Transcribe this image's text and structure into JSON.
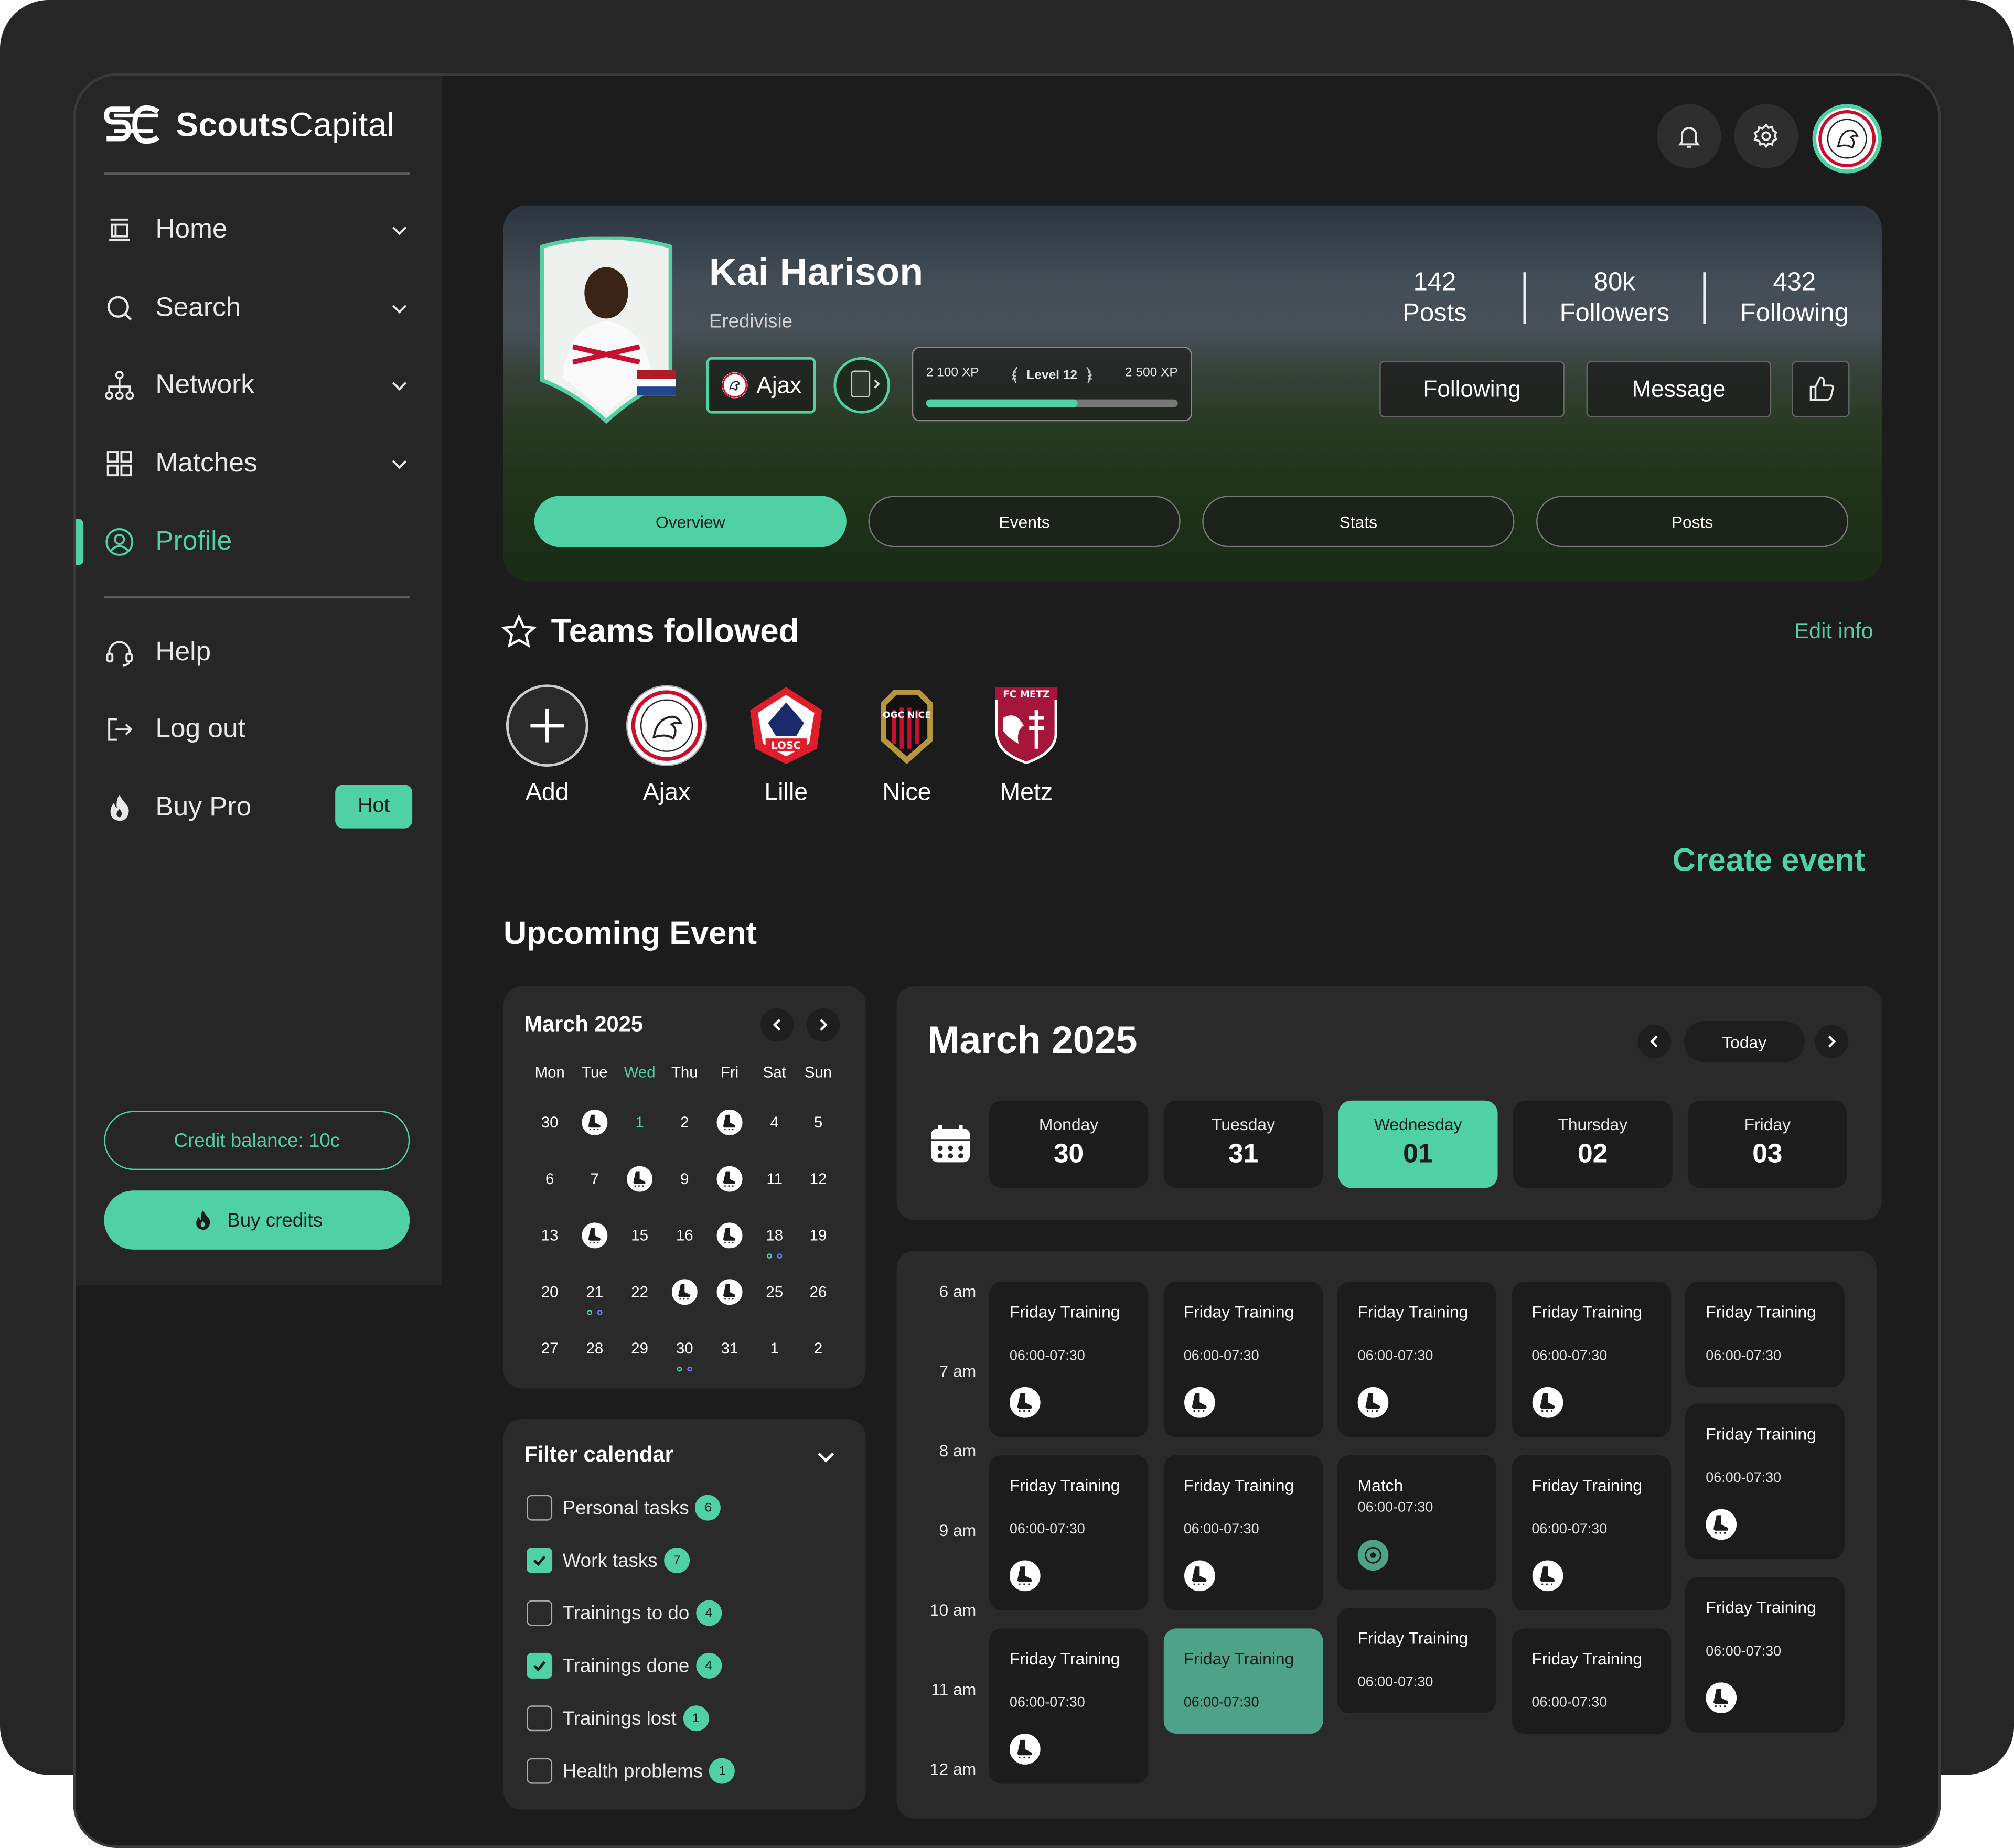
{
  "brand": {
    "bold": "Scouts",
    "light": "Capital"
  },
  "nav": {
    "home": "Home",
    "search": "Search",
    "network": "Network",
    "matches": "Matches",
    "profile": "Profile",
    "help": "Help",
    "logout": "Log out",
    "buy_pro": "Buy Pro",
    "hot_badge": "Hot"
  },
  "credits": {
    "balance": "Credit balance: 10c",
    "buy": "Buy credits"
  },
  "player": {
    "name": "Kai Harison",
    "league": "Eredivisie",
    "club": "Ajax",
    "xp_current": "2 100 XP",
    "level": "Level 12",
    "xp_next": "2 500 XP",
    "xp_progress": 0.6
  },
  "stats": [
    {
      "value": "142",
      "label": "Posts"
    },
    {
      "value": "80k",
      "label": "Followers"
    },
    {
      "value": "432",
      "label": "Following"
    }
  ],
  "actions": {
    "following": "Following",
    "message": "Message"
  },
  "tabs": [
    "Overview",
    "Events",
    "Stats",
    "Posts"
  ],
  "teams_section": {
    "title": "Teams followed",
    "edit": "Edit info",
    "teams": [
      "Add",
      "Ajax",
      "Lille",
      "Nice",
      "Metz"
    ],
    "logo_text": {
      "lille": "LOSC",
      "nice": "OGC NICE",
      "metz": "FC METZ"
    }
  },
  "create_event": "Create event",
  "upcoming_title": "Upcoming Event",
  "mini_calendar": {
    "title": "March 2025",
    "weekdays": [
      "Mon",
      "Tue",
      "Wed",
      "Thu",
      "Fri",
      "Sat",
      "Sun"
    ],
    "weeks": [
      [
        "30",
        "",
        "1",
        "2",
        "",
        "4",
        "5"
      ],
      [
        "6",
        "7",
        "",
        "9",
        "",
        "11",
        "12"
      ],
      [
        "13",
        "",
        "15",
        "16",
        "",
        "18",
        "19"
      ],
      [
        "20",
        "21",
        "22",
        "",
        "",
        "25",
        "26"
      ],
      [
        "27",
        "28",
        "29",
        "30",
        "31",
        "1",
        "2"
      ]
    ]
  },
  "filter": {
    "title": "Filter calendar",
    "items": [
      {
        "label": "Personal tasks",
        "count": "6",
        "checked": false
      },
      {
        "label": "Work tasks",
        "count": "7",
        "checked": true
      },
      {
        "label": "Trainings to do",
        "count": "4",
        "checked": false
      },
      {
        "label": "Trainings done",
        "count": "4",
        "checked": true
      },
      {
        "label": "Trainings lost",
        "count": "1",
        "checked": false
      },
      {
        "label": "Health problems",
        "count": "1",
        "checked": false
      }
    ]
  },
  "week_calendar": {
    "title": "March 2025",
    "today": "Today",
    "days": [
      {
        "name": "Monday",
        "date": "30"
      },
      {
        "name": "Tuesday",
        "date": "31"
      },
      {
        "name": "Wednesday",
        "date": "01"
      },
      {
        "name": "Thursday",
        "date": "02"
      },
      {
        "name": "Friday",
        "date": "03"
      }
    ],
    "hours": [
      "6 am",
      "7 am",
      "8 am",
      "9 am",
      "10 am",
      "11 am",
      "12 am"
    ]
  },
  "events": {
    "training": "Friday Training",
    "match": "Match",
    "time": "06:00-07:30"
  },
  "colors": {
    "accent": "#4fd1a5",
    "bg": "#1c1c1c",
    "panel": "#2a2a2a",
    "highlight": "#4fa28a"
  }
}
